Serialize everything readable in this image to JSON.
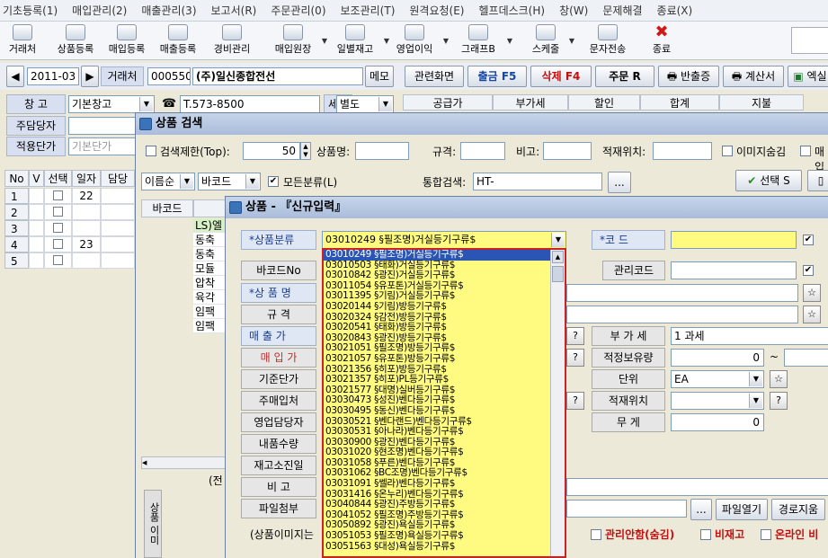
{
  "menu": [
    "기초등록(1)",
    "매입관리(2)",
    "매출관리(3)",
    "보고서(R)",
    "주문관리(0)",
    "보조관리(T)",
    "원격요청(E)",
    "헬프데스크(H)",
    "창(W)",
    "문제해결",
    "종료(X)"
  ],
  "toolbar": [
    {
      "label": "거래처",
      "icon": "building-icon"
    },
    {
      "label": "상품등록",
      "icon": "product-icon"
    },
    {
      "label": "매입등록",
      "icon": "purchase-icon"
    },
    {
      "label": "매출등록",
      "icon": "sales-icon"
    },
    {
      "label": "경비관리",
      "icon": "money-icon"
    },
    {
      "label": "매입원장",
      "icon": "ledger-icon"
    },
    {
      "label": "일별재고",
      "icon": "stock-icon"
    },
    {
      "label": "영업이익",
      "icon": "profit-icon"
    },
    {
      "label": "그래프B",
      "icon": "chart-icon"
    },
    {
      "label": "스케줄",
      "icon": "calendar-icon"
    },
    {
      "label": "문자전송",
      "icon": "sms-icon"
    },
    {
      "label": "종료",
      "icon": "close-icon"
    }
  ],
  "main": {
    "date": "2011-03",
    "partner_label": "거래처",
    "partner_code": "000550",
    "partner_name": "(주)일신종합전선",
    "memo": "메모",
    "related": "관련화면",
    "out": "출금 F5",
    "del": "삭제 F4",
    "order": "주문 R",
    "return": "반출증",
    "calc": "계산서",
    "excel": "엑실",
    "warehouse_label": "창      고",
    "warehouse_value": "기본창고",
    "tel": "T.573-8500",
    "tax_label": "세액",
    "tax_value": "별도",
    "manager_label": "주담당자",
    "applied_label": "적용단가",
    "applied_value": "기본단가",
    "summary_headers": [
      "공급가",
      "부가세",
      "할인",
      "합계",
      "지불"
    ],
    "grid_headers": [
      "No",
      "V",
      "선택",
      "일자",
      "담당"
    ],
    "rows": [
      {
        "no": "1",
        "day": "22"
      },
      {
        "no": "2",
        "day": ""
      },
      {
        "no": "3",
        "day": ""
      },
      {
        "no": "4",
        "day": "23"
      },
      {
        "no": "5",
        "day": ""
      }
    ]
  },
  "search": {
    "title": "상품 검색",
    "limit_label": "검색제한(Top):",
    "limit_value": "50",
    "name_label": "상품명:",
    "spec_label": "규격:",
    "note_label": "비고:",
    "loc_label": "적재위치:",
    "hide_img": "이미지숨김",
    "sell": "매입",
    "sort": "이름순",
    "sort2": "바코드",
    "all_class": "모든분류(L)",
    "integrated_label": "통합검색:",
    "integrated_value": "HT-",
    "ellipsis": "...",
    "select_btn": "선택 S",
    "col_barcode": "바코드",
    "list_rows": [
      "LS)엘",
      "동축",
      "동축",
      "모듈",
      "압착",
      "육각",
      "임팩",
      "임팩"
    ],
    "bottom": "(전"
  },
  "product": {
    "title": "상품 - 『신규입력』",
    "category_label": "*상품분류",
    "category_value": "03010249 §필조명)거실등기구류$",
    "code_label": "*코      드",
    "barcode_label": "바코드No",
    "mgmt_label": "관리코드",
    "name_label": "*상 품 명",
    "spec_label": "규    격",
    "sale_label": "매 출 가",
    "buy_label": "매 입 가",
    "std_label": "기준단가",
    "main_buy_label": "주매입처",
    "sales_mgr_label": "영업담당자",
    "qty_label": "내품수량",
    "stock_label": "재고소진일",
    "note_label": "비    고",
    "file_label": "파일첨부",
    "vat_label": "부 가 세",
    "vat_value": "1 과세",
    "proper_label": "적정보유량",
    "proper_value": "0",
    "unit_label": "단위",
    "unit_value": "EA",
    "loc_label": "적재위치",
    "weight_label": "무    게",
    "weight_value": "0",
    "file_open": "파일열기",
    "path_clear": "경로지움",
    "img_note": "(상품이미지는",
    "manage_no": "관리안함(숨김)",
    "no_stock": "비재고",
    "online": "온라인 비",
    "side_label": "상품 이미",
    "q": "?",
    "star": "☆",
    "tilde": "~"
  },
  "dropdown": [
    "03010249 §필조명)거실등기구류$",
    "03010503 §태화)거실등기구류$",
    "03010842 §광진)거실등기구류$",
    "03011054 §유포톤)거실등기구류$",
    "03011395 §기림)거실등기구류$",
    "03020144 §기림)방등기구류$",
    "03020324 §감전)방등기구류$",
    "03020541 §태화)방등기구류$",
    "03020843 §광진)방등기구류$",
    "03021051 §필조명)방등기구류$",
    "03021057 §유포톤)방등기구류$",
    "03021356 §히포)방등기구류$",
    "03021357 §히포)PL등기구류$",
    "03021577 §대명)실버등기구류$",
    "03030473 §성진)벤다등기구류$",
    "03030495 §동신)벤다등기구류$",
    "03030521 §벤다랜드)벤다등기구류$",
    "03030531 §아나라)벤다등기구류$",
    "03030900 §광진)벤다등기구류$",
    "03031020 §현조명)벤다등기구류$",
    "03031058 §푸른)벤다등기구류$",
    "03031062 §BC조명)벤다등기구류$",
    "03031091 §쎌라)벤다등기구류$",
    "03031416 §온누리)벤다등기구류$",
    "03040844 §광진)주방등기구류$",
    "03041052 §필조명)주방등기구류$",
    "03050892 §광진)욕실등기구류$",
    "03051053 §필조명)욕실등기구류$",
    "03051563 §대성)욕실등기구류$"
  ]
}
